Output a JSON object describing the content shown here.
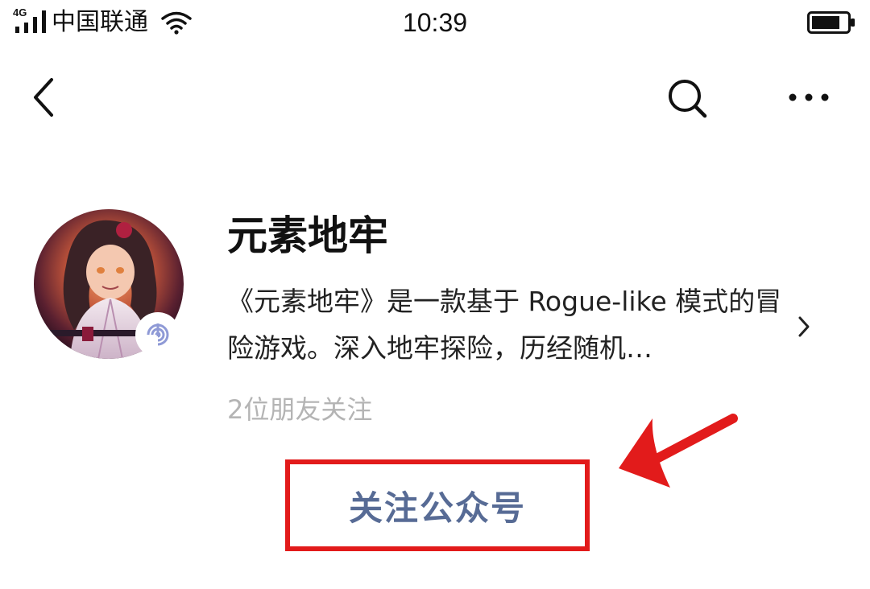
{
  "status_bar": {
    "network_type": "4G",
    "carrier": "中国联通",
    "time": "10:39",
    "icons": [
      "signal-icon",
      "wifi-icon",
      "battery-icon"
    ]
  },
  "nav_bar": {
    "icons": [
      "back-icon",
      "search-icon",
      "more-icon"
    ]
  },
  "profile": {
    "name": "元素地牢",
    "description": "《元素地牢》是一款基于 Rogue-like 模式的冒险游戏。深入地牢探险，历经随机…",
    "followers_text": "2位朋友关注",
    "follow_button_label": "关注公众号"
  },
  "colors": {
    "follow_text": "#576b95",
    "annotation_red": "#e21b1b",
    "muted_text": "#b4b4b4"
  }
}
